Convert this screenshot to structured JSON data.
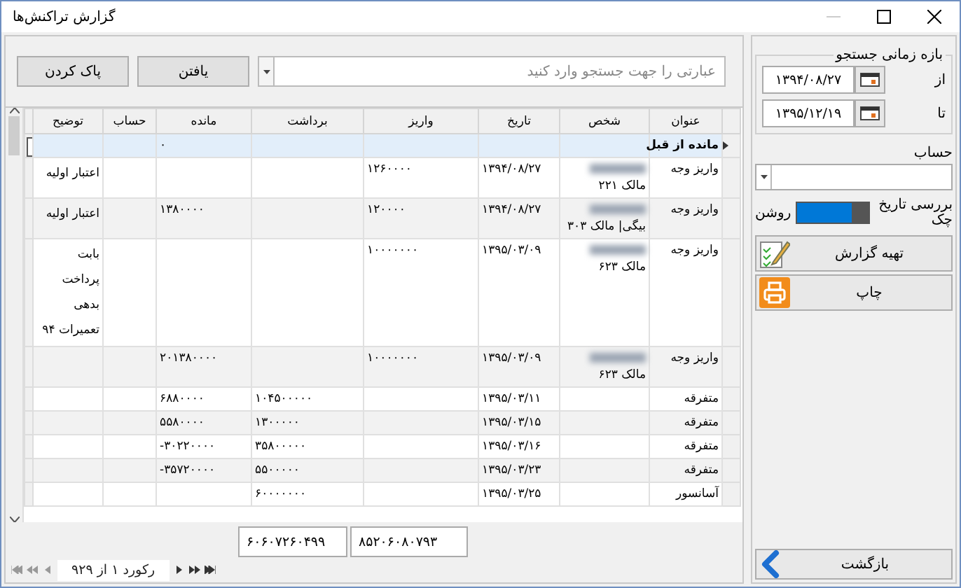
{
  "window": {
    "title": "گزارش تراکنش‌ها"
  },
  "search": {
    "placeholder": "عبارتی را جهت جستجو وارد کنید",
    "buttons": [
      "یافتن",
      "پاک کردن"
    ]
  },
  "table": {
    "columns": [
      "عنوان",
      "شخص",
      "تاریخ",
      "واریز",
      "برداشت",
      "مانده",
      "حساب",
      "توضیح"
    ],
    "rows": [
      {
        "selected": true,
        "title": "مانده از قبل",
        "person": "",
        "name_blurred": false,
        "date": "",
        "deposit": "",
        "withdrawal": "",
        "balance": "۰",
        "account": "",
        "note": ""
      },
      {
        "selected": false,
        "title": "واریز وجه",
        "person": "مالک ۲۲۱",
        "name_blurred": true,
        "date": "۱۳۹۴/۰۸/۲۷",
        "deposit": "۱۲۶۰۰۰۰",
        "withdrawal": "",
        "balance": "",
        "account": "",
        "note": "اعتبار اولیه"
      },
      {
        "selected": false,
        "title": "واریز وجه",
        "person": "بیگی| مالک ۳۰۳",
        "name_blurred": true,
        "date": "۱۳۹۴/۰۸/۲۷",
        "deposit": "۱۲۰۰۰۰",
        "withdrawal": "",
        "balance": "۱۳۸۰۰۰۰",
        "account": "",
        "note": "اعتبار اولیه"
      },
      {
        "selected": false,
        "title": "واریز وجه",
        "person": "مالک ۶۲۳",
        "name_blurred": true,
        "date": "۱۳۹۵/۰۳/۰۹",
        "deposit": "۱۰۰۰۰۰۰۰",
        "withdrawal": "",
        "balance": "",
        "account": "",
        "note": "بابت پرداخت بدهی تعمیرات ۹۴"
      },
      {
        "selected": false,
        "title": "واریز وجه",
        "person": "مالک ۶۲۳",
        "name_blurred": true,
        "date": "۱۳۹۵/۰۳/۰۹",
        "deposit": "۱۰۰۰۰۰۰۰",
        "withdrawal": "",
        "balance": "۲۰۱۳۸۰۰۰۰",
        "account": "",
        "note": ""
      },
      {
        "selected": false,
        "title": "متفرقه",
        "person": "",
        "name_blurred": false,
        "date": "۱۳۹۵/۰۳/۱۱",
        "deposit": "",
        "withdrawal": "۱۰۴۵۰۰۰۰۰",
        "balance": "۶۸۸۰۰۰۰",
        "account": "",
        "note": ""
      },
      {
        "selected": false,
        "title": "متفرقه",
        "person": "",
        "name_blurred": false,
        "date": "۱۳۹۵/۰۳/۱۵",
        "deposit": "",
        "withdrawal": "۱۳۰۰۰۰۰",
        "balance": "۵۵۸۰۰۰۰",
        "account": "",
        "note": ""
      },
      {
        "selected": false,
        "title": "متفرقه",
        "person": "",
        "name_blurred": false,
        "date": "۱۳۹۵/۰۳/۱۶",
        "deposit": "",
        "withdrawal": "۳۵۸۰۰۰۰۰",
        "balance": "-۳۰۲۲۰۰۰۰",
        "account": "",
        "note": ""
      },
      {
        "selected": false,
        "title": "متفرقه",
        "person": "",
        "name_blurred": false,
        "date": "۱۳۹۵/۰۳/۲۳",
        "deposit": "",
        "withdrawal": "۵۵۰۰۰۰۰",
        "balance": "-۳۵۷۲۰۰۰۰",
        "account": "",
        "note": ""
      },
      {
        "selected": false,
        "title": "آسانسور",
        "person": "",
        "name_blurred": false,
        "date": "۱۳۹۵/۰۳/۲۵",
        "deposit": "",
        "withdrawal": "۶۰۰۰۰۰۰۰",
        "balance": "",
        "account": "",
        "note": ""
      }
    ],
    "totals": {
      "deposit": "۸۵۲۰۶۰۸۰۷۹۳",
      "withdrawal": "۶۰۶۰۷۲۶۰۴۹۹"
    },
    "navigator": "رکورد ۱ از ۹۲۹"
  },
  "sidebar": {
    "range_title": "بازه زمانی جستجو",
    "from_label": "از",
    "from_value": "۱۳۹۴/۰۸/۲۷",
    "to_label": "تا",
    "to_value": "۱۳۹۵/۱۲/۱۹",
    "account_label": "حساب",
    "check_label": "بررسی تاریخ چک",
    "check_state": "روشن",
    "check_on": true,
    "report_button": "تهیه گزارش",
    "print_button": "چاپ",
    "back_button": "بازگشت"
  }
}
